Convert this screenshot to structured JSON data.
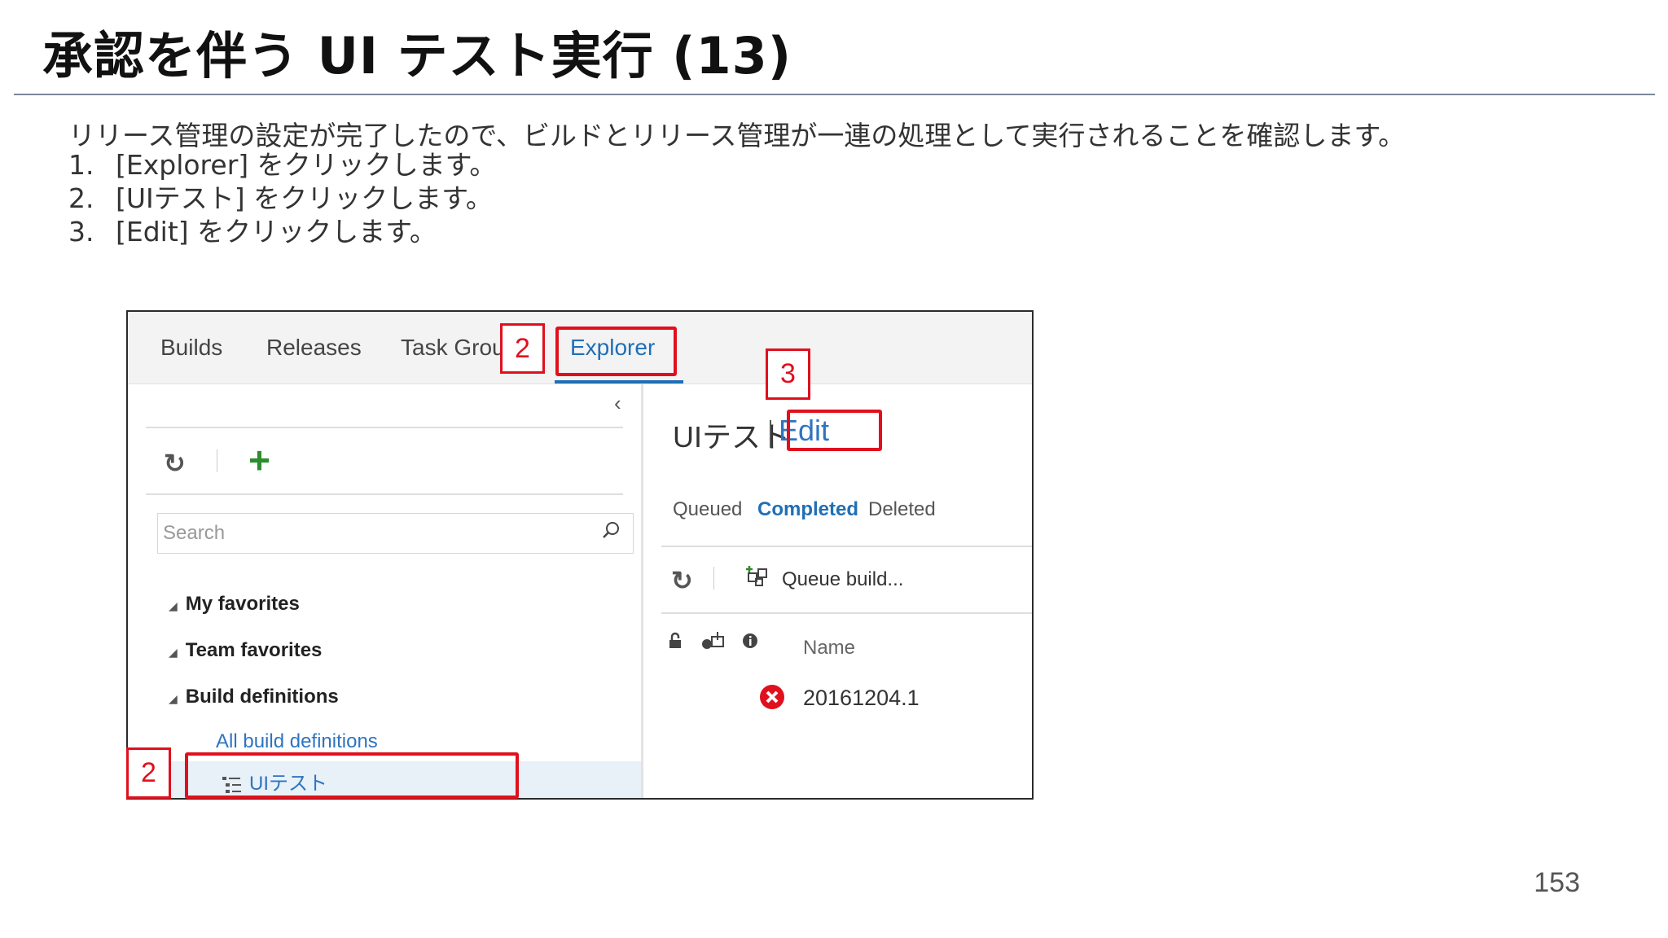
{
  "slide": {
    "title": "承認を伴う UI テスト実行 (13)",
    "intro": "リリース管理の設定が完了したので、ビルドとリリース管理が一連の処理として実行されることを確認します。",
    "steps": [
      {
        "num": "1.",
        "text": "[Explorer] をクリックします。"
      },
      {
        "num": "2.",
        "text": "[UIテスト] をクリックします。"
      },
      {
        "num": "3.",
        "text": "[Edit] をクリックします。"
      }
    ],
    "page_number": "153"
  },
  "screenshot": {
    "tabs": [
      "Builds",
      "Releases",
      "Task Grou",
      "Explorer"
    ],
    "active_tab": "Explorer",
    "search_placeholder": "Search",
    "tree": {
      "my_favorites": "My favorites",
      "team_favorites": "Team favorites",
      "build_definitions": "Build definitions",
      "all_build_definitions": "All build definitions",
      "selected_definition": "UIテスト"
    },
    "definition_title": "UIテスト",
    "edit_label": "Edit",
    "build_tabs": [
      "Queued",
      "Completed",
      "Deleted"
    ],
    "active_build_tab": "Completed",
    "queue_build_label": "Queue build...",
    "column_name": "Name",
    "builds": [
      {
        "status": "failed",
        "name": "20161204.1"
      }
    ]
  },
  "annotations": {
    "explorer_badge": "2",
    "edit_badge": "3",
    "tree_badge": "2",
    "color": "#e0101d"
  },
  "colors": {
    "accent_blue": "#1f6fb6",
    "add_green": "#2c8d2c",
    "error_red": "#e0101d"
  }
}
